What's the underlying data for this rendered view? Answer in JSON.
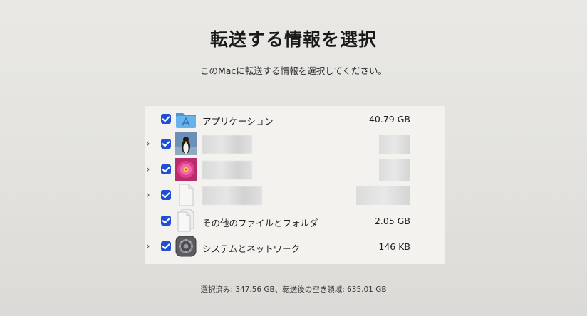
{
  "header": {
    "title": "転送する情報を選択",
    "subtitle": "このMacに転送する情報を選択してください。"
  },
  "items": [
    {
      "name": "アプリケーション",
      "size": "40.79 GB",
      "checked": true,
      "expandable": false,
      "icon": "applications-folder-icon"
    },
    {
      "name": "",
      "size": "",
      "checked": true,
      "expandable": true,
      "icon": "user-penguin-avatar-icon",
      "redacted": true
    },
    {
      "name": "",
      "size": "",
      "checked": true,
      "expandable": true,
      "icon": "user-flower-avatar-icon",
      "redacted": true
    },
    {
      "name": "",
      "size": "",
      "checked": true,
      "expandable": true,
      "icon": "document-icon",
      "redacted": true
    },
    {
      "name": "その他のファイルとフォルダ",
      "size": "2.05 GB",
      "checked": true,
      "expandable": false,
      "icon": "documents-icon"
    },
    {
      "name": "システムとネットワーク",
      "size": "146 KB",
      "checked": true,
      "expandable": true,
      "icon": "system-settings-icon"
    }
  ],
  "footer": {
    "summary": "選択済み: 347.56 GB、転送後の空き領域: 635.01 GB"
  },
  "colors": {
    "checkbox": "#1e4fd6",
    "folder": "#5aa6e0",
    "background": "#e6e5e1"
  }
}
